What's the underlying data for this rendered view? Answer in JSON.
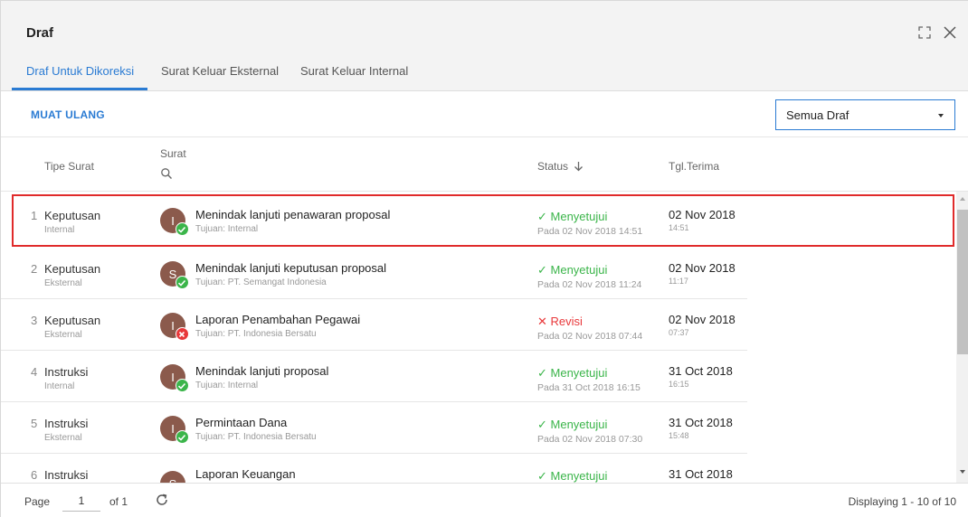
{
  "window": {
    "title": "Draf"
  },
  "tabs": [
    {
      "label": "Draf Untuk Dikoreksi",
      "active": true
    },
    {
      "label": "Surat Keluar Eksternal",
      "active": false
    },
    {
      "label": "Surat Keluar Internal",
      "active": false
    }
  ],
  "toolbar": {
    "reload_label": "MUAT ULANG",
    "filter_selected": "Semua Draf"
  },
  "table": {
    "headers": {
      "tipe": "Tipe Surat",
      "surat": "Surat",
      "status": "Status",
      "tgl": "Tgl.Terima"
    },
    "rows": [
      {
        "num": "1",
        "tipe": "Keputusan",
        "sub": "Internal",
        "avatar": "I",
        "badge": "ok",
        "subject": "Menindak lanjuti penawaran proposal",
        "tujuan": "Tujuan: Internal",
        "status": "✓ Menyetujui",
        "status_kind": "ok",
        "pada": "Pada 02 Nov 2018 14:51",
        "tgl": "02 Nov 2018",
        "jam": "14:51"
      },
      {
        "num": "2",
        "tipe": "Keputusan",
        "sub": "Eksternal",
        "avatar": "S",
        "badge": "ok",
        "subject": "Menindak lanjuti keputusan proposal",
        "tujuan": "Tujuan: PT. Semangat Indonesia",
        "status": "✓ Menyetujui",
        "status_kind": "ok",
        "pada": "Pada 02 Nov 2018 11:24",
        "tgl": "02 Nov 2018",
        "jam": "11:17"
      },
      {
        "num": "3",
        "tipe": "Keputusan",
        "sub": "Eksternal",
        "avatar": "I",
        "badge": "no",
        "subject": "Laporan Penambahan Pegawai",
        "tujuan": "Tujuan: PT. Indonesia Bersatu",
        "status": "✕ Revisi",
        "status_kind": "no",
        "pada": "Pada 02 Nov 2018 07:44",
        "tgl": "02 Nov 2018",
        "jam": "07:37"
      },
      {
        "num": "4",
        "tipe": "Instruksi",
        "sub": "Internal",
        "avatar": "I",
        "badge": "ok",
        "subject": "Menindak lanjuti proposal",
        "tujuan": "Tujuan: Internal",
        "status": "✓ Menyetujui",
        "status_kind": "ok",
        "pada": "Pada 31 Oct 2018 16:15",
        "tgl": "31 Oct 2018",
        "jam": "16:15"
      },
      {
        "num": "5",
        "tipe": "Instruksi",
        "sub": "Eksternal",
        "avatar": "I",
        "badge": "ok",
        "subject": "Permintaan Dana",
        "tujuan": "Tujuan: PT. Indonesia Bersatu",
        "status": "✓ Menyetujui",
        "status_kind": "ok",
        "pada": "Pada 02 Nov 2018 07:30",
        "tgl": "31 Oct 2018",
        "jam": "15:48"
      },
      {
        "num": "6",
        "tipe": "Instruksi",
        "sub": "",
        "avatar": "S",
        "badge": "",
        "subject": "Laporan Keuangan",
        "tujuan": "",
        "status": "✓ Menyetujui",
        "status_kind": "ok",
        "pada": "",
        "tgl": "31 Oct 2018",
        "jam": ""
      }
    ]
  },
  "footer": {
    "page_label": "Page",
    "page_value": "1",
    "of_label": "of 1",
    "displaying": "Displaying 1 - 10 of 10"
  },
  "colors": {
    "accent": "#2a7bd3",
    "approve": "#3bb54a",
    "revise": "#e8383a",
    "avatar": "#8b5a4c",
    "selection": "#e02b2b"
  },
  "icons": {
    "expand": "expand-icon",
    "close": "close-icon",
    "search": "search-icon",
    "sort": "arrow-down-icon",
    "refresh": "refresh-icon",
    "approve": "check-icon",
    "revise": "x-icon"
  }
}
